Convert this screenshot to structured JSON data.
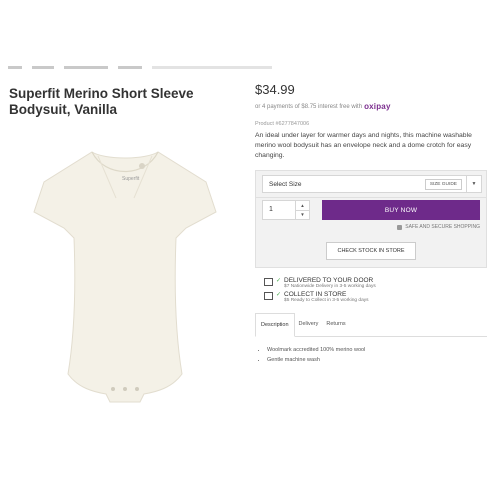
{
  "breadcrumb": [
    "",
    "",
    "",
    "",
    ""
  ],
  "product": {
    "title": "Superfit Merino Short Sleeve Bodysuit, Vanilla",
    "price": "$34.99",
    "installment_text": "or 4 payments of $8.75 interest free with",
    "installment_provider": "oxipay",
    "sku": "Product #6277847006",
    "description": "An ideal under layer for warmer days and nights, this machine washable merino wool bodysuit has an envelope neck and a dome crotch for easy changing.",
    "image_label": "Superfit"
  },
  "size": {
    "label": "Select Size",
    "guide_label": "SIZE GUIDE"
  },
  "quantity": {
    "value": "1"
  },
  "buy_label": "BUY NOW",
  "secure_label": "SAFE AND SECURE SHOPPING",
  "stock_label": "CHECK STOCK IN STORE",
  "delivery_options": [
    {
      "title": "DELIVERED TO YOUR DOOR",
      "sub": "$7 Nationwide Delivery in 3-5 working days"
    },
    {
      "title": "COLLECT IN STORE",
      "sub": "$5 Ready to Collect in 3-5 working days"
    }
  ],
  "tabs": [
    "Description",
    "Delivery",
    "Returns"
  ],
  "features": [
    "Woolmark accredited 100% merino wool",
    "Gentle machine wash"
  ],
  "colors": {
    "accent": "#6e2a8a",
    "check": "#4caf50"
  }
}
